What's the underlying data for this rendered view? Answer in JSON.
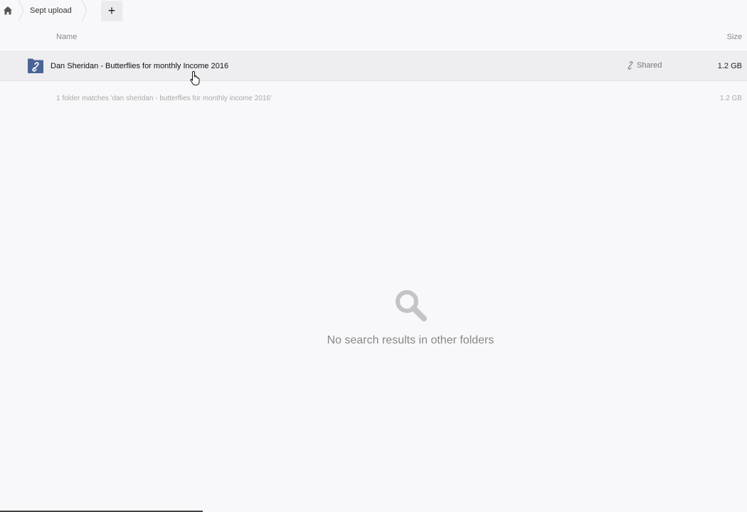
{
  "breadcrumb": {
    "home_icon": "home-icon",
    "current": "Sept upload",
    "add_label": "+"
  },
  "table": {
    "headers": {
      "name": "Name",
      "size": "Size"
    },
    "rows": [
      {
        "name": "Dan Sheridan - Butterflies for monthly Income 2016",
        "shared": "Shared",
        "size": "1.2 GB",
        "icon": "shared-folder-icon"
      }
    ],
    "summary": "1 folder matches 'dan sheridan - butterflies for monthly income 2016'",
    "summary_size": "1.2 GB"
  },
  "empty_state": {
    "icon": "search-icon",
    "message": "No search results in other folders"
  },
  "colors": {
    "background": "#f8f7f9",
    "folder": "#4a6496",
    "row_highlight": "#eeedf0"
  }
}
